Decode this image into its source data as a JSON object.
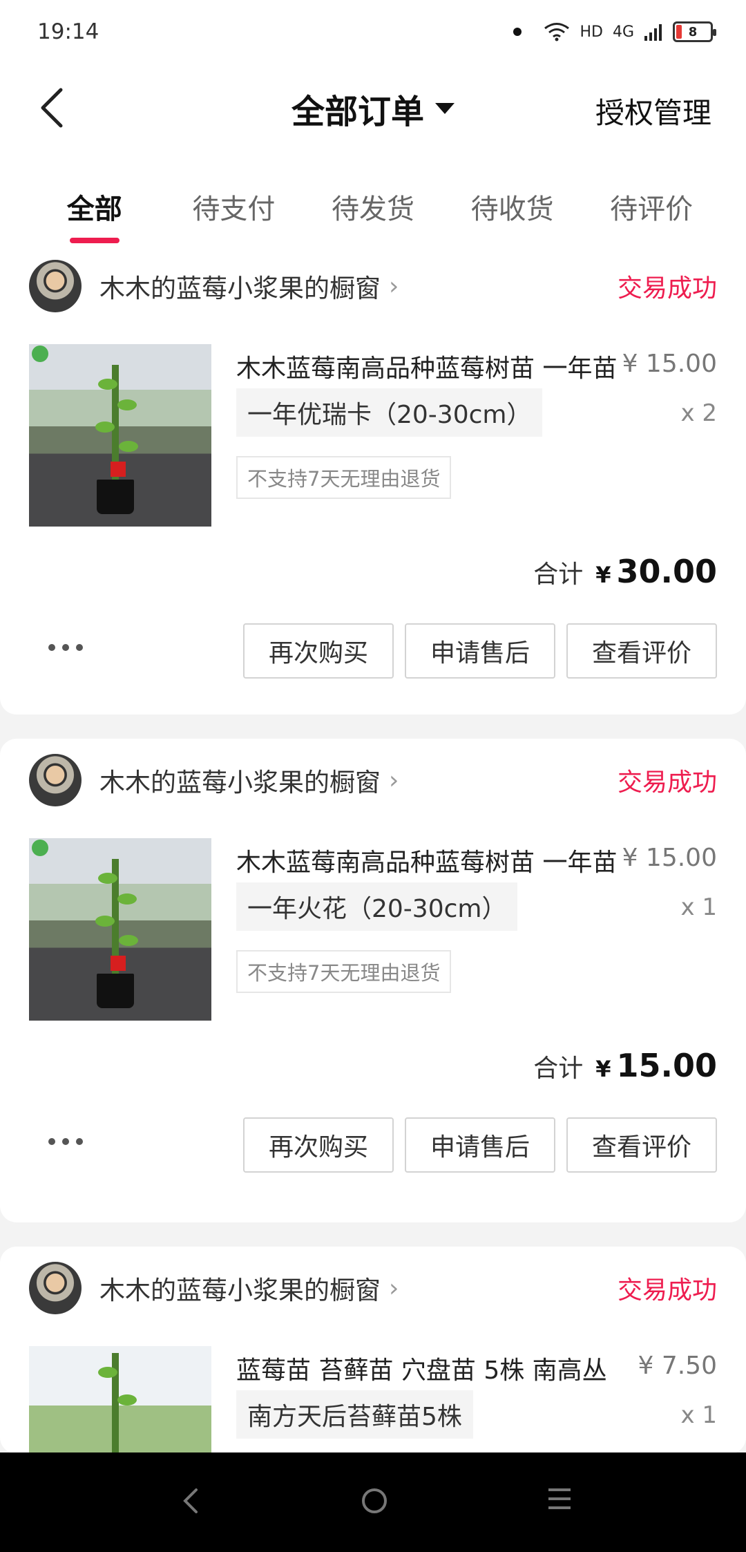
{
  "status_bar": {
    "time": "19:14",
    "network": "4G",
    "hd": "HD",
    "battery": "8"
  },
  "header": {
    "title": "全部订单",
    "right_action": "授权管理"
  },
  "tabs": [
    {
      "label": "全部",
      "active": true
    },
    {
      "label": "待支付",
      "active": false
    },
    {
      "label": "待发货",
      "active": false
    },
    {
      "label": "待收货",
      "active": false
    },
    {
      "label": "待评价",
      "active": false
    }
  ],
  "orders": [
    {
      "shop_name": "木木的蓝莓小浆果的橱窗",
      "status": "交易成功",
      "product_name": "木木蓝莓南高品种蓝莓树苗 一年苗",
      "price": "¥ 15.00",
      "sku": "一年优瑞卡（20-30cm）",
      "quantity": "x 2",
      "policy": "不支持7天无理由退货",
      "total_label": "合计",
      "currency": "¥",
      "total": "30.00",
      "buttons": [
        "再次购买",
        "申请售后",
        "查看评价"
      ]
    },
    {
      "shop_name": "木木的蓝莓小浆果的橱窗",
      "status": "交易成功",
      "product_name": "木木蓝莓南高品种蓝莓树苗 一年苗",
      "price": "¥ 15.00",
      "sku": "一年火花（20-30cm）",
      "quantity": "x 1",
      "policy": "不支持7天无理由退货",
      "total_label": "合计",
      "currency": "¥",
      "total": "15.00",
      "buttons": [
        "再次购买",
        "申请售后",
        "查看评价"
      ]
    },
    {
      "shop_name": "木木的蓝莓小浆果的橱窗",
      "status": "交易成功",
      "product_name": "蓝莓苗 苔藓苗 穴盘苗 5株 南高丛",
      "price": "¥ 7.50",
      "sku": "南方天后苔藓苗5株",
      "quantity": "x 1"
    }
  ],
  "colors": {
    "accent": "#ee1d4f",
    "background": "#f3f3f3"
  }
}
